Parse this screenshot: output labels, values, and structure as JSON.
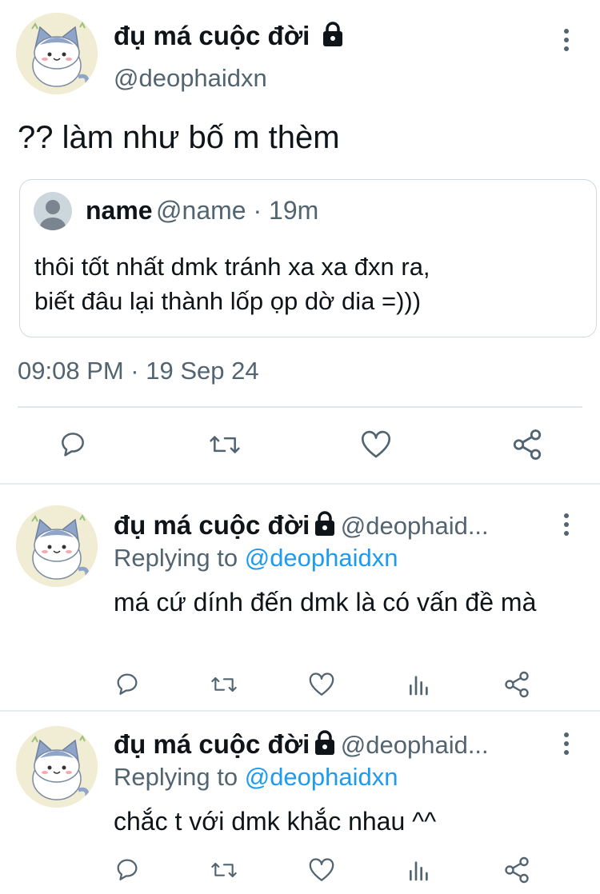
{
  "main_tweet": {
    "display_name": "đụ má cuộc đời",
    "handle": "@deophaidxn",
    "text": "?? làm như bố m thèm",
    "quote": {
      "display_name": "name",
      "meta": "@name · 19m",
      "text": "thôi tốt nhất dmk tránh xa xa đxn ra,\nbiết đâu lại thành lốp ọp dờ dia =)))"
    },
    "timestamp": "09:08 PM · 19 Sep 24"
  },
  "replies": [
    {
      "display_name": "đụ má cuộc đời",
      "handle": "@deophaid...",
      "replying_label": "Replying to",
      "replying_mention": "@deophaidxn",
      "text": "má cứ dính đến dmk là có vấn đề mà"
    },
    {
      "display_name": "đụ má cuộc đời",
      "handle": "@deophaid...",
      "replying_label": "Replying to",
      "replying_mention": "@deophaidxn",
      "text": "chắc t với dmk khắc nhau ^^"
    }
  ],
  "icons": {
    "action_color": "#536471",
    "reply": "reply-icon",
    "retweet": "retweet-icon",
    "like": "like-icon",
    "views": "views-icon",
    "share": "share-icon",
    "lock": "lock-icon",
    "more": "more-icon"
  },
  "colors": {
    "text": "#0f1419",
    "secondary": "#536471",
    "mention": "#1d9bf0",
    "border": "#cfd9de"
  }
}
